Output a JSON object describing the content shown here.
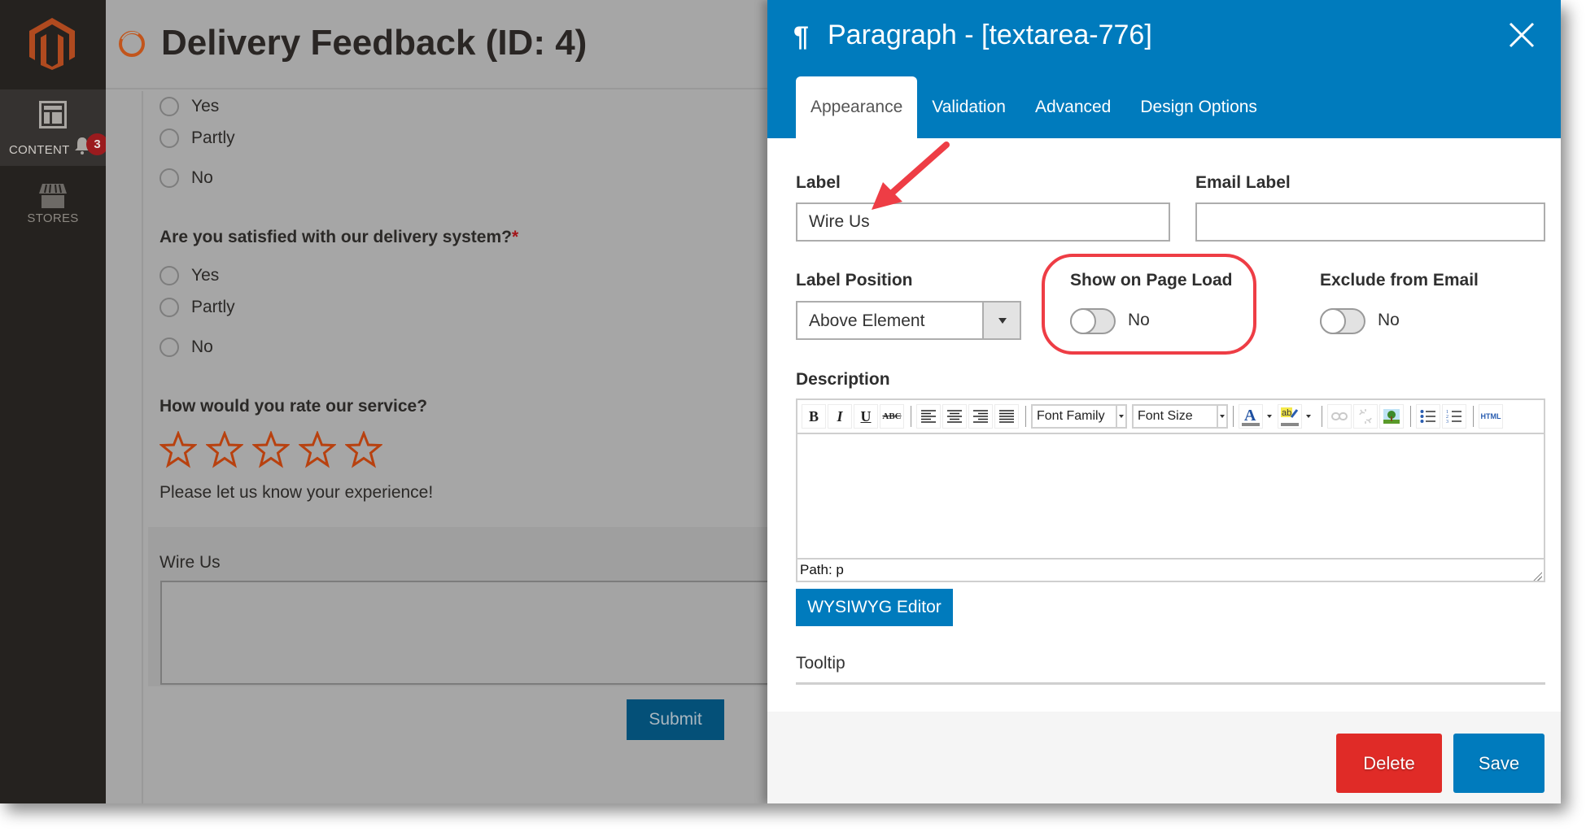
{
  "sidebar": {
    "logo": "magento-logo",
    "items": [
      {
        "label": "CONTENT",
        "icon": "content-layout-icon",
        "notification_count": "3"
      },
      {
        "label": "STORES",
        "icon": "store-icon"
      }
    ]
  },
  "page": {
    "title": "Delivery Feedback (ID: 4)",
    "form": {
      "partial_question_options": [
        "Yes",
        "Partly",
        "No"
      ],
      "question2": {
        "text": "Are you satisfied with our delivery system?",
        "required_mark": "*",
        "options": [
          "Yes",
          "Partly",
          "No"
        ]
      },
      "question3": {
        "text": "How would you rate our service?",
        "rating_max": 5,
        "rating_value": 0,
        "hint": "Please let us know your experience!"
      },
      "textarea_block": {
        "label": "Wire Us",
        "value": ""
      },
      "submit_label": "Submit"
    }
  },
  "panel": {
    "title_icon": "¶",
    "title": "Paragraph - [textarea-776]",
    "tabs": [
      {
        "label": "Appearance",
        "active": true
      },
      {
        "label": "Validation",
        "active": false
      },
      {
        "label": "Advanced",
        "active": false
      },
      {
        "label": "Design Options",
        "active": false
      }
    ],
    "fields": {
      "label": {
        "title": "Label",
        "value": "Wire Us"
      },
      "email_label": {
        "title": "Email Label",
        "value": ""
      },
      "label_position": {
        "title": "Label Position",
        "selected": "Above Element"
      },
      "show_on_page_load": {
        "title": "Show on Page Load",
        "state": "No",
        "on": false
      },
      "exclude_from_email": {
        "title": "Exclude from Email",
        "state": "No",
        "on": false
      },
      "description": {
        "title": "Description",
        "toolbar": {
          "font_family": "Font Family",
          "font_size": "Font Size",
          "html_label": "HTML"
        },
        "path": "Path: p",
        "wysiwyg_button": "WYSIWYG Editor"
      },
      "tooltip": {
        "title": "Tooltip"
      }
    },
    "footer": {
      "delete_label": "Delete",
      "save_label": "Save"
    }
  },
  "annotations": {
    "arrow_target": "label-input",
    "highlight_target": "show-on-page-load",
    "color": "#ee3d45"
  },
  "colors": {
    "primary_blue": "#007bbd",
    "delete_red": "#e02b27",
    "magento_orange": "#eb5202",
    "sidebar_dark": "#25221f"
  }
}
